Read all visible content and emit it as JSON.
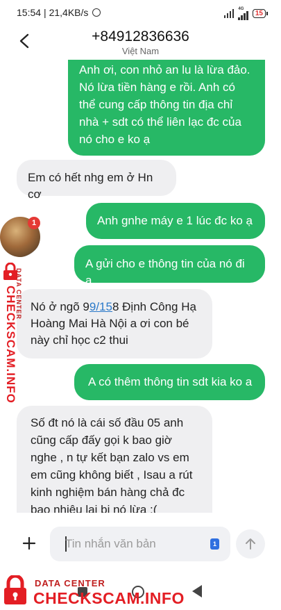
{
  "status_bar": {
    "time": "15:54",
    "speed": "| 21,4KB/s",
    "network": "4G",
    "battery": "15"
  },
  "header": {
    "contact_number": "+84912836636",
    "country": "Việt Nam"
  },
  "messages": [
    {
      "type": "sent",
      "text": "Anh ơi, con nhỏ an lu là lừa đảo. Nó lừa tiền hàng e rồi. Anh có thể cung cấp thông tin địa chỉ nhà + sdt có thể liên lạc đc của nó cho e ko ạ"
    },
    {
      "type": "received",
      "text": "Em có hết nhg em ở Hn cơ"
    },
    {
      "type": "sent",
      "text": "Anh  gnhe máy e 1 lúc đc ko ạ"
    },
    {
      "type": "sent",
      "text": "A gửi cho e thông tin của nó đi ạ"
    },
    {
      "type": "received",
      "text_before": "Nó ở ngõ 9",
      "link": "9/15",
      "text_after": "8 Định Công Hạ Hoàng Mai Hà Nội a ơi con bé này chỉ học c2 thui"
    },
    {
      "type": "sent",
      "text": "A có thêm thông tin sdt kia ko a"
    },
    {
      "type": "received",
      "text": "Số đt nó là cái số đầu 05 anh cũng cấp đấy gọi k bao giờ nghe , n tự kết bạn zalo vs em em cũng không biết , Isau a rút kinh nghiệm bán hàng chả đc bao nhiêu lại bị nó lừa :("
    }
  ],
  "composer": {
    "placeholder": "Tin nhắn văn bản",
    "sim_label": "1"
  },
  "watermark": {
    "notification_count": "1",
    "line_small": "DATA CENTER",
    "line_big": "CHECKSCAM.INFO",
    "brand_color": "#e31e24"
  },
  "colors": {
    "sent_bubble": "#27b866",
    "received_bubble": "#efeff1",
    "link": "#2a79c9"
  }
}
